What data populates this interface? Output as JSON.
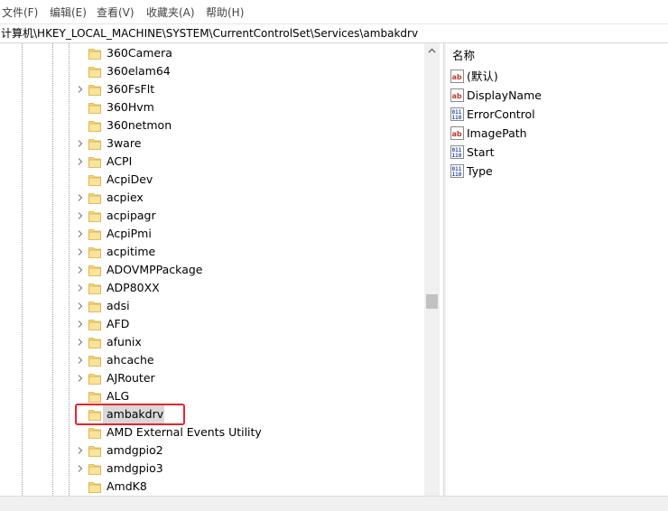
{
  "menu": [
    "文件(F)",
    "编辑(E)",
    "查看(V)",
    "收藏夹(A)",
    "帮助(H)"
  ],
  "address": "计算机\\HKEY_LOCAL_MACHINE\\SYSTEM\\CurrentControlSet\\Services\\ambakdrv",
  "tree": {
    "items": [
      {
        "label": "360Camera",
        "expandable": false
      },
      {
        "label": "360elam64",
        "expandable": false
      },
      {
        "label": "360FsFlt",
        "expandable": true
      },
      {
        "label": "360Hvm",
        "expandable": false
      },
      {
        "label": "360netmon",
        "expandable": false
      },
      {
        "label": "3ware",
        "expandable": true
      },
      {
        "label": "ACPI",
        "expandable": true
      },
      {
        "label": "AcpiDev",
        "expandable": false
      },
      {
        "label": "acpiex",
        "expandable": true
      },
      {
        "label": "acpipagr",
        "expandable": true
      },
      {
        "label": "AcpiPmi",
        "expandable": true
      },
      {
        "label": "acpitime",
        "expandable": true
      },
      {
        "label": "ADOVMPPackage",
        "expandable": true
      },
      {
        "label": "ADP80XX",
        "expandable": true
      },
      {
        "label": "adsi",
        "expandable": true
      },
      {
        "label": "AFD",
        "expandable": true
      },
      {
        "label": "afunix",
        "expandable": true
      },
      {
        "label": "ahcache",
        "expandable": true
      },
      {
        "label": "AJRouter",
        "expandable": true
      },
      {
        "label": "ALG",
        "expandable": false
      },
      {
        "label": "ambakdrv",
        "expandable": false,
        "selected": true
      },
      {
        "label": "AMD External Events Utility",
        "expandable": false
      },
      {
        "label": "amdgpio2",
        "expandable": true
      },
      {
        "label": "amdgpio3",
        "expandable": true
      },
      {
        "label": "AmdK8",
        "expandable": false
      }
    ]
  },
  "values": {
    "header": "名称",
    "items": [
      {
        "label": "(默认)",
        "icon": "string-value-icon"
      },
      {
        "label": "DisplayName",
        "icon": "string-value-icon"
      },
      {
        "label": "ErrorControl",
        "icon": "dword-value-icon"
      },
      {
        "label": "ImagePath",
        "icon": "string-value-icon"
      },
      {
        "label": "Start",
        "icon": "dword-value-icon"
      },
      {
        "label": "Type",
        "icon": "dword-value-icon"
      }
    ]
  },
  "colors": {
    "highlight": "#e8242a",
    "folder": "#f8d775",
    "selection": "#d9d9d9"
  }
}
